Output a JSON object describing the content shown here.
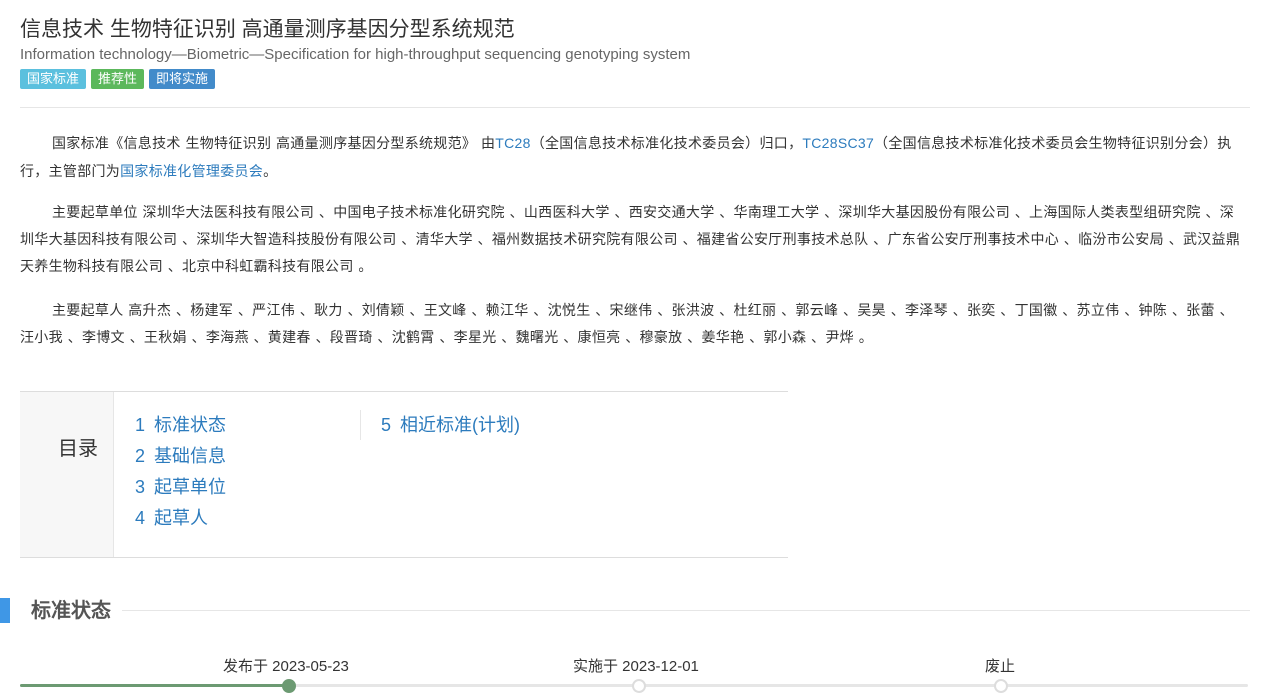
{
  "title_cn": "信息技术 生物特征识别 高通量测序基因分型系统规范",
  "title_en": "Information technology—Biometric—Specification for high-throughput sequencing genotyping system",
  "badges": [
    {
      "label": "国家标准",
      "color": "#5bc0de"
    },
    {
      "label": "推荐性",
      "color": "#5cb85c"
    },
    {
      "label": "即将实施",
      "color": "#428bca"
    }
  ],
  "intro": {
    "prefix": "国家标准《信息技术 生物特征识别 高通量测序基因分型系统规范》 由",
    "tc_link": "TC28",
    "tc_text": "（全国信息技术标准化技术委员会）归口，",
    "sc_link": "TC28SC37",
    "sc_text": "（全国信息技术标准化技术委员会生物特征识别分会）执行，主管部门为",
    "dept_link": "国家标准化管理委员会",
    "suffix": "。"
  },
  "drafting_units": "主要起草单位 深圳华大法医科技有限公司 、中国电子技术标准化研究院 、山西医科大学 、西安交通大学 、华南理工大学 、深圳华大基因股份有限公司 、上海国际人类表型组研究院 、深圳华大基因科技有限公司 、深圳华大智造科技股份有限公司 、清华大学 、福州数据技术研究院有限公司 、福建省公安厅刑事技术总队 、广东省公安厅刑事技术中心 、临汾市公安局 、武汉益鼎天养生物科技有限公司 、北京中科虹霸科技有限公司 。",
  "drafters": "主要起草人 高升杰 、杨建军 、严江伟 、耿力 、刘倩颖 、王文峰 、赖江华 、沈悦生 、宋继伟 、张洪波 、杜红丽 、郭云峰 、吴昊 、李泽琴 、张奕 、丁国徽 、苏立伟 、钟陈 、张蕾 、汪小我 、李博文 、王秋娟 、李海燕 、黄建春 、段晋琦 、沈鹤霄 、李星光 、魏曙光 、康恒亮 、穆豪放 、姜华艳 、郭小森 、尹烨 。",
  "toc": {
    "label": "目录",
    "items": [
      {
        "num": "1",
        "label": "标准状态"
      },
      {
        "num": "2",
        "label": "基础信息"
      },
      {
        "num": "3",
        "label": "起草单位"
      },
      {
        "num": "4",
        "label": "起草人"
      },
      {
        "num": "5",
        "label": "相近标准(计划)"
      }
    ]
  },
  "status_section": {
    "title": "标准状态",
    "timeline": [
      {
        "label": "发布于 2023-05-23",
        "state": "done"
      },
      {
        "label": "实施于 2023-12-01",
        "state": "pending"
      },
      {
        "label": "废止",
        "state": "pending"
      }
    ]
  }
}
